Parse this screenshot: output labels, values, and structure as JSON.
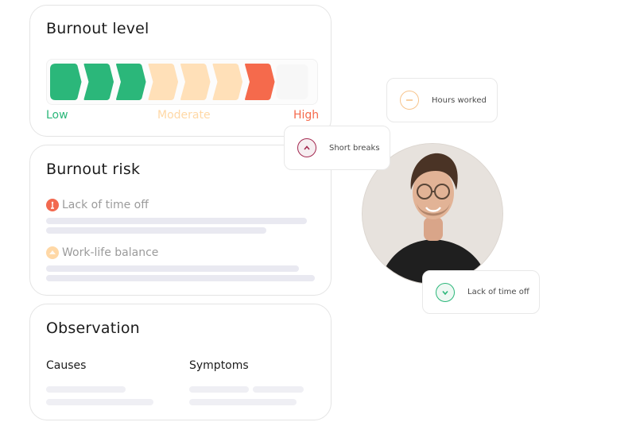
{
  "burnout_level": {
    "title": "Burnout level",
    "segments_total": 8,
    "segments_filled": 7,
    "segment_colors": [
      "#2bb77a",
      "#2bb77a",
      "#2bb77a",
      "#ffe0b8",
      "#ffe0b8",
      "#ffe0b8",
      "#f56a4c"
    ],
    "empty_color": "#f7f7f7",
    "scale": [
      {
        "label": "Low",
        "color": "#2bb77a"
      },
      {
        "label": "Moderate",
        "color": "#ffd8a6"
      },
      {
        "label": "High",
        "color": "#f56a4c"
      }
    ]
  },
  "burnout_risk": {
    "title": "Burnout risk",
    "items": [
      {
        "label": "Lack of time off",
        "icon": "alert-icon",
        "color": "#f2694f"
      },
      {
        "label": "Work-life balance",
        "icon": "balance-icon",
        "color": "#ffd8a6"
      }
    ]
  },
  "observation": {
    "title": "Observation",
    "causes_label": "Causes",
    "symptoms_label": "Symptoms"
  },
  "chips": {
    "hours_worked": {
      "label": "Hours worked",
      "icon": "minus-icon",
      "color": "#f7c48c"
    },
    "short_breaks": {
      "label": "Short breaks",
      "icon": "chevron-up-icon",
      "color": "#a3284f"
    },
    "lack_of_time_off": {
      "label": "Lack of time off",
      "icon": "chevron-down-icon",
      "color": "#2bb77a"
    }
  }
}
